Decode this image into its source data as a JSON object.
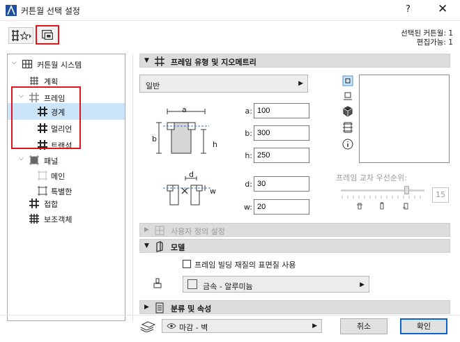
{
  "window": {
    "title": "커튼월 선택 설정",
    "help": "?",
    "close": "✕"
  },
  "status": {
    "selected": "선택된 커튼월: 1",
    "editable": "편집가능: 1"
  },
  "tree": {
    "items": [
      {
        "label": "커튼월 시스템",
        "level": 0
      },
      {
        "label": "계획",
        "level": 1
      },
      {
        "label": "프레임",
        "level": 1
      },
      {
        "label": "경계",
        "level": 2
      },
      {
        "label": "멀리언",
        "level": 2
      },
      {
        "label": "트랜섬",
        "level": 2
      },
      {
        "label": "패널",
        "level": 1
      },
      {
        "label": "메인",
        "level": 2
      },
      {
        "label": "특별한",
        "level": 2
      },
      {
        "label": "접합",
        "level": 1
      },
      {
        "label": "보조객체",
        "level": 1
      }
    ]
  },
  "frame_panel": {
    "title": "프레임 유형 및 지오메트리",
    "type_value": "일반",
    "dims_top": {
      "a_label": "a",
      "b_label": "b",
      "h_label": "h"
    },
    "dims_bottom": {
      "d_label": "d",
      "w_label": "w"
    },
    "fields": [
      {
        "label": "a:",
        "value": "100"
      },
      {
        "label": "b:",
        "value": "300"
      },
      {
        "label": "h:",
        "value": "250"
      },
      {
        "label": "d:",
        "value": "30"
      },
      {
        "label": "w:",
        "value": "20"
      }
    ],
    "priority_label": "프레임 교차 우선순위:",
    "priority_value": "15"
  },
  "custom_panel": {
    "title": "사용자 정의 설정"
  },
  "model_panel": {
    "title": "모델",
    "checkbox_label": "프레임 빌딩 재질의 표면질 사용",
    "material": "금속 - 알루미늄"
  },
  "classification_panel": {
    "title": "분류 및 속성"
  },
  "footer": {
    "layer": "마감 - 벽",
    "cancel": "취소",
    "ok": "확인"
  }
}
